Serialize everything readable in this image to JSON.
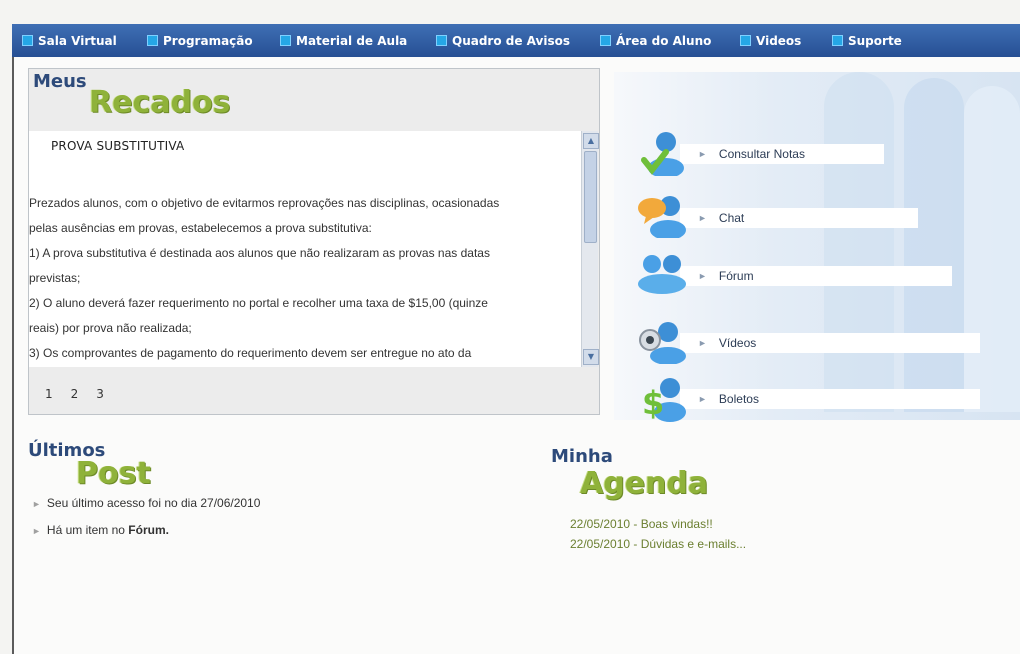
{
  "nav": {
    "items": [
      {
        "label": "Sala Virtual"
      },
      {
        "label": "Programação"
      },
      {
        "label": "Material de Aula"
      },
      {
        "label": "Quadro de Avisos"
      },
      {
        "label": "Área do Aluno"
      },
      {
        "label": "Videos"
      },
      {
        "label": "Suporte"
      }
    ]
  },
  "recados": {
    "title_small": "Meus",
    "title_big": "Recados",
    "message_title": "PROVA SUBSTITUTIVA",
    "lines": [
      "Prezados alunos, com o objetivo de evitarmos reprovações nas disciplinas, ocasionadas",
      "pelas ausências em provas, estabelecemos a prova substitutiva:",
      "1) A prova substitutiva é destinada aos alunos que não realizaram as provas nas datas",
      "previstas;",
      "2) O aluno deverá fazer requerimento no portal e recolher uma taxa de $15,00 (quinze",
      "reais) por prova não realizada;",
      "3) Os comprovantes de pagamento do requerimento devem ser entregue no ato da"
    ],
    "pages": [
      "1",
      "2",
      "3"
    ]
  },
  "menu": {
    "items": [
      {
        "label": "Consultar Notas",
        "icon": "user-check-icon"
      },
      {
        "label": "Chat",
        "icon": "user-chat-icon"
      },
      {
        "label": "Fórum",
        "icon": "users-forum-icon"
      },
      {
        "label": "Vídeos",
        "icon": "user-webcam-icon"
      },
      {
        "label": "Boletos",
        "icon": "user-dollar-icon"
      }
    ]
  },
  "posts": {
    "title_small": "Últimos",
    "title_big": "Post",
    "items": [
      {
        "text": "Seu último acesso foi no dia 27/06/2010"
      },
      {
        "text_prefix": "Há um item no ",
        "text_bold": "Fórum."
      }
    ]
  },
  "agenda": {
    "title_small": "Minha",
    "title_big": "Agenda",
    "items": [
      {
        "date": "22/05/2010",
        "text": " - Boas vindas!!"
      },
      {
        "date": "22/05/2010",
        "text": " - Dúvidas e e-mails..."
      }
    ]
  },
  "colors": {
    "nav_bg": "#2f5fa6",
    "title_blue": "#2d4a7a",
    "title_green": "#8fb23a",
    "agenda_green": "#6b7f30"
  }
}
